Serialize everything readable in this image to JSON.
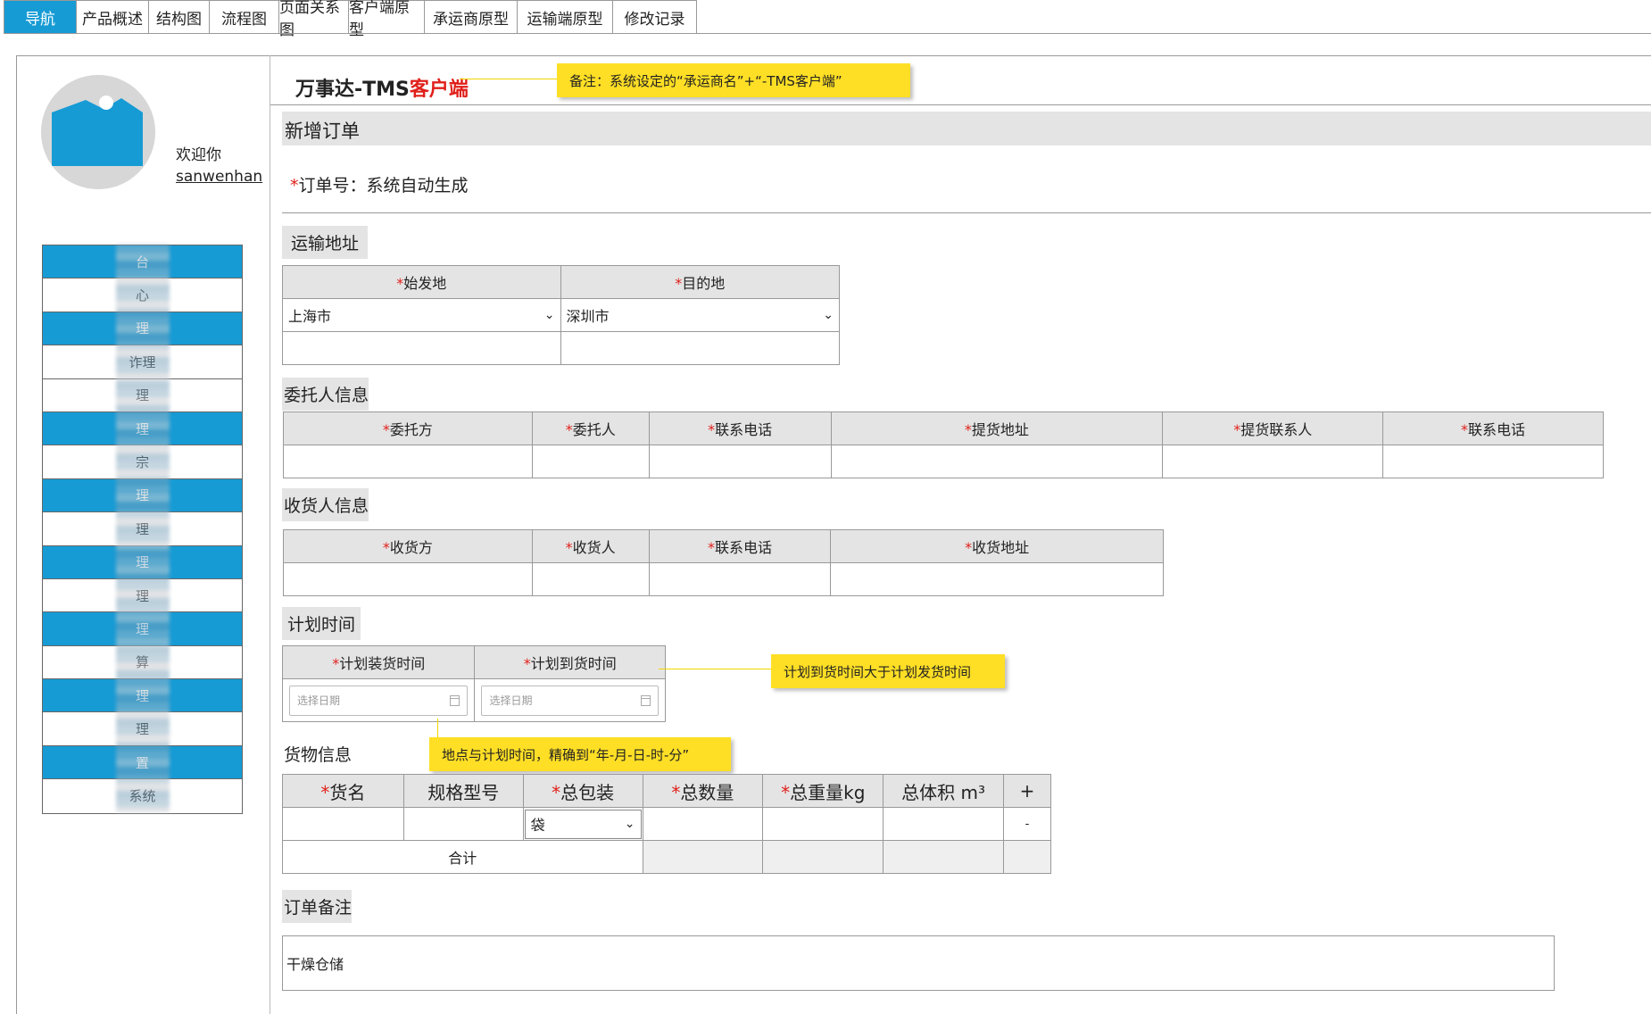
{
  "top_nav": {
    "tabs": [
      {
        "label": "导航",
        "active": true
      },
      {
        "label": "产品概述"
      },
      {
        "label": "结构图"
      },
      {
        "label": "流程图"
      },
      {
        "label": "页面关系图"
      },
      {
        "label": "客户端原型"
      },
      {
        "label": "承运商原型"
      },
      {
        "label": "运输端原型"
      },
      {
        "label": "修改记录"
      }
    ]
  },
  "user": {
    "welcome": "欢迎你",
    "username": "sanwenhan"
  },
  "sidebar": {
    "items": [
      {
        "label": "台",
        "style": "blue"
      },
      {
        "label": "心",
        "style": "white"
      },
      {
        "label": "理",
        "style": "blue"
      },
      {
        "label": "诈理",
        "style": "white"
      },
      {
        "label": "理",
        "style": "white"
      },
      {
        "label": "理",
        "style": "blue"
      },
      {
        "label": "宗",
        "style": "white"
      },
      {
        "label": "理",
        "style": "blue"
      },
      {
        "label": "理",
        "style": "white"
      },
      {
        "label": "理",
        "style": "blue"
      },
      {
        "label": "理",
        "style": "white"
      },
      {
        "label": "理",
        "style": "blue"
      },
      {
        "label": "算",
        "style": "white"
      },
      {
        "label": "理",
        "style": "blue"
      },
      {
        "label": "理",
        "style": "white"
      },
      {
        "label": "置",
        "style": "blue"
      },
      {
        "label": "系统",
        "style": "white"
      }
    ]
  },
  "header": {
    "title_main": "万事达-TMS",
    "title_red": "客户端",
    "note": "备注：系统设定的“承运商名”+“-TMS客户端”"
  },
  "page_title": "新增订单",
  "order_no": {
    "label": "订单号：系统自动生成"
  },
  "address": {
    "section": "运输地址",
    "origin_label": "始发地",
    "dest_label": "目的地",
    "origin_value": "上海市",
    "dest_value": "深圳市"
  },
  "consignor": {
    "section": "委托人信息",
    "columns": [
      "委托方",
      "委托人",
      "联系电话",
      "提货地址",
      "提货联系人",
      "联系电话"
    ]
  },
  "consignee": {
    "section": "收货人信息",
    "columns": [
      "收货方",
      "收货人",
      "联系电话",
      "收货地址"
    ]
  },
  "plan_time": {
    "section": "计划时间",
    "load_label": "计划装货时间",
    "arrive_label": "计划到货时间",
    "placeholder": "选择日期",
    "note_right": "计划到货时间大于计划发货时间",
    "note_below": "地点与计划时间，精确到“年-月-日-时-分”"
  },
  "goods": {
    "section": "货物信息",
    "columns": [
      {
        "label": "货名",
        "required": true
      },
      {
        "label": "规格型号",
        "required": false
      },
      {
        "label": "总包装",
        "required": true
      },
      {
        "label": "总数量",
        "required": true
      },
      {
        "label": "总重量kg",
        "required": true
      },
      {
        "label": "总体积 m³",
        "required": false
      }
    ],
    "add": "+",
    "remove": "-",
    "pack_value": "袋",
    "total_label": "合计"
  },
  "remark": {
    "section": "订单备注",
    "value": "干燥仓储"
  },
  "colors": {
    "accent": "#169bd5",
    "note": "#ffdf25",
    "required": "#e0201b",
    "header_bg": "#e4e4e4"
  }
}
